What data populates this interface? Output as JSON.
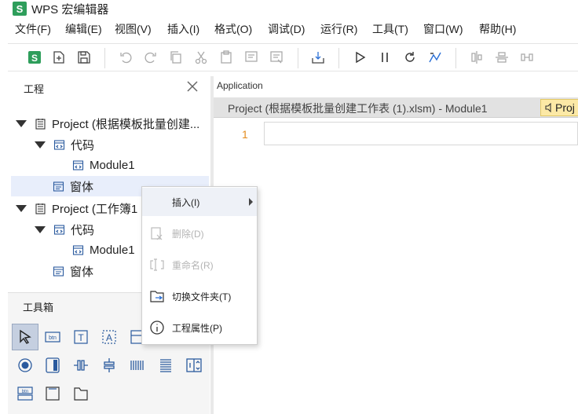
{
  "window": {
    "logo": "S",
    "title": "WPS 宏编辑器"
  },
  "menu": [
    "文件(F)",
    "编辑(E)",
    "视图(V)",
    "插入(I)",
    "格式(O)",
    "调试(D)",
    "运行(R)",
    "工具(T)",
    "窗口(W)",
    "帮助(H)"
  ],
  "toolbar": {
    "logo_letter": "S",
    "icons": [
      "wps-logo-icon",
      "new-module-icon",
      "save-icon",
      "undo-icon",
      "redo-icon",
      "copy-icon",
      "cut-icon",
      "paste-icon",
      "comment-icon",
      "uncomment-icon",
      "import-icon",
      "run-icon",
      "pause-icon",
      "reset-icon",
      "design-mode-icon",
      "align-center-icon",
      "align-middle-icon",
      "distribute-icon"
    ]
  },
  "project_panel": {
    "title": "工程",
    "tree": [
      {
        "label": "Project (根据模板批量创建...",
        "icon": "project-icon"
      },
      {
        "label": "代码",
        "icon": "code-folder-icon"
      },
      {
        "label": "Module1",
        "icon": "module-icon"
      },
      {
        "label": "窗体",
        "icon": "form-folder-icon"
      },
      {
        "label": "Project (工作簿1",
        "icon": "project-icon"
      },
      {
        "label": "代码",
        "icon": "code-folder-icon"
      },
      {
        "label": "Module1",
        "icon": "module-icon"
      },
      {
        "label": "窗体",
        "icon": "form-folder-icon"
      }
    ]
  },
  "toolbox": {
    "title": "工具箱",
    "tools": [
      "pointer-icon",
      "command-button-icon",
      "label-icon",
      "textbox-icon",
      "frame-icon",
      "listbox-icon",
      "combobox-icon",
      "option-button-icon",
      "toggle-button-icon",
      "scrollbar-h-icon",
      "scrollbar-v-icon",
      "slider-icon",
      "image-icon",
      "spin-button-icon",
      "button-tool-icon",
      "text-field-icon",
      "folder-tool-icon"
    ],
    "labels": {
      "btn": "btn",
      "text": "T",
      "a": "A"
    }
  },
  "editor": {
    "object_label": "Application",
    "doc_tab": "Project (根据模板批量创建工作表 (1).xlsm) - Module1",
    "proc_tab": "Proj",
    "line_number": "1",
    "accent": "#e38c1e"
  },
  "context_menu": {
    "items": [
      {
        "label": "插入(I)",
        "enabled": true,
        "has_submenu": true
      },
      {
        "label": "删除(D)",
        "enabled": false
      },
      {
        "label": "重命名(R)",
        "enabled": false
      },
      {
        "label": "切换文件夹(T)",
        "enabled": true
      },
      {
        "label": "工程属性(P)",
        "enabled": true
      }
    ]
  }
}
